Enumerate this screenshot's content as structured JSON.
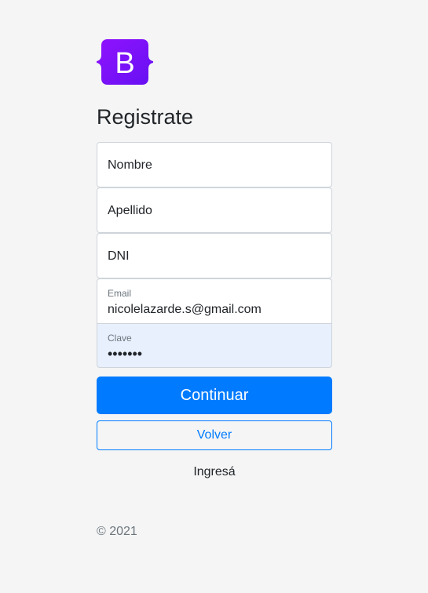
{
  "brand": {
    "logo_letter": "B",
    "logo_colors": [
      "#7952b3",
      "#8d1cf5",
      "#6f08ee"
    ]
  },
  "page": {
    "title": "Registrate"
  },
  "form": {
    "nombre_placeholder": "Nombre",
    "apellido_placeholder": "Apellido",
    "dni_placeholder": "DNI",
    "email_label": "Email",
    "email_value": "nicolelazarde.s@gmail.com",
    "clave_label": "Clave",
    "clave_value": "•••••••"
  },
  "actions": {
    "continue_label": "Continuar",
    "back_label": "Volver",
    "login_link": "Ingresá"
  },
  "footer": {
    "copyright": "© 2021"
  },
  "colors": {
    "primary": "#007bff",
    "background": "#f5f5f5",
    "autofill": "#e8f0fe"
  }
}
